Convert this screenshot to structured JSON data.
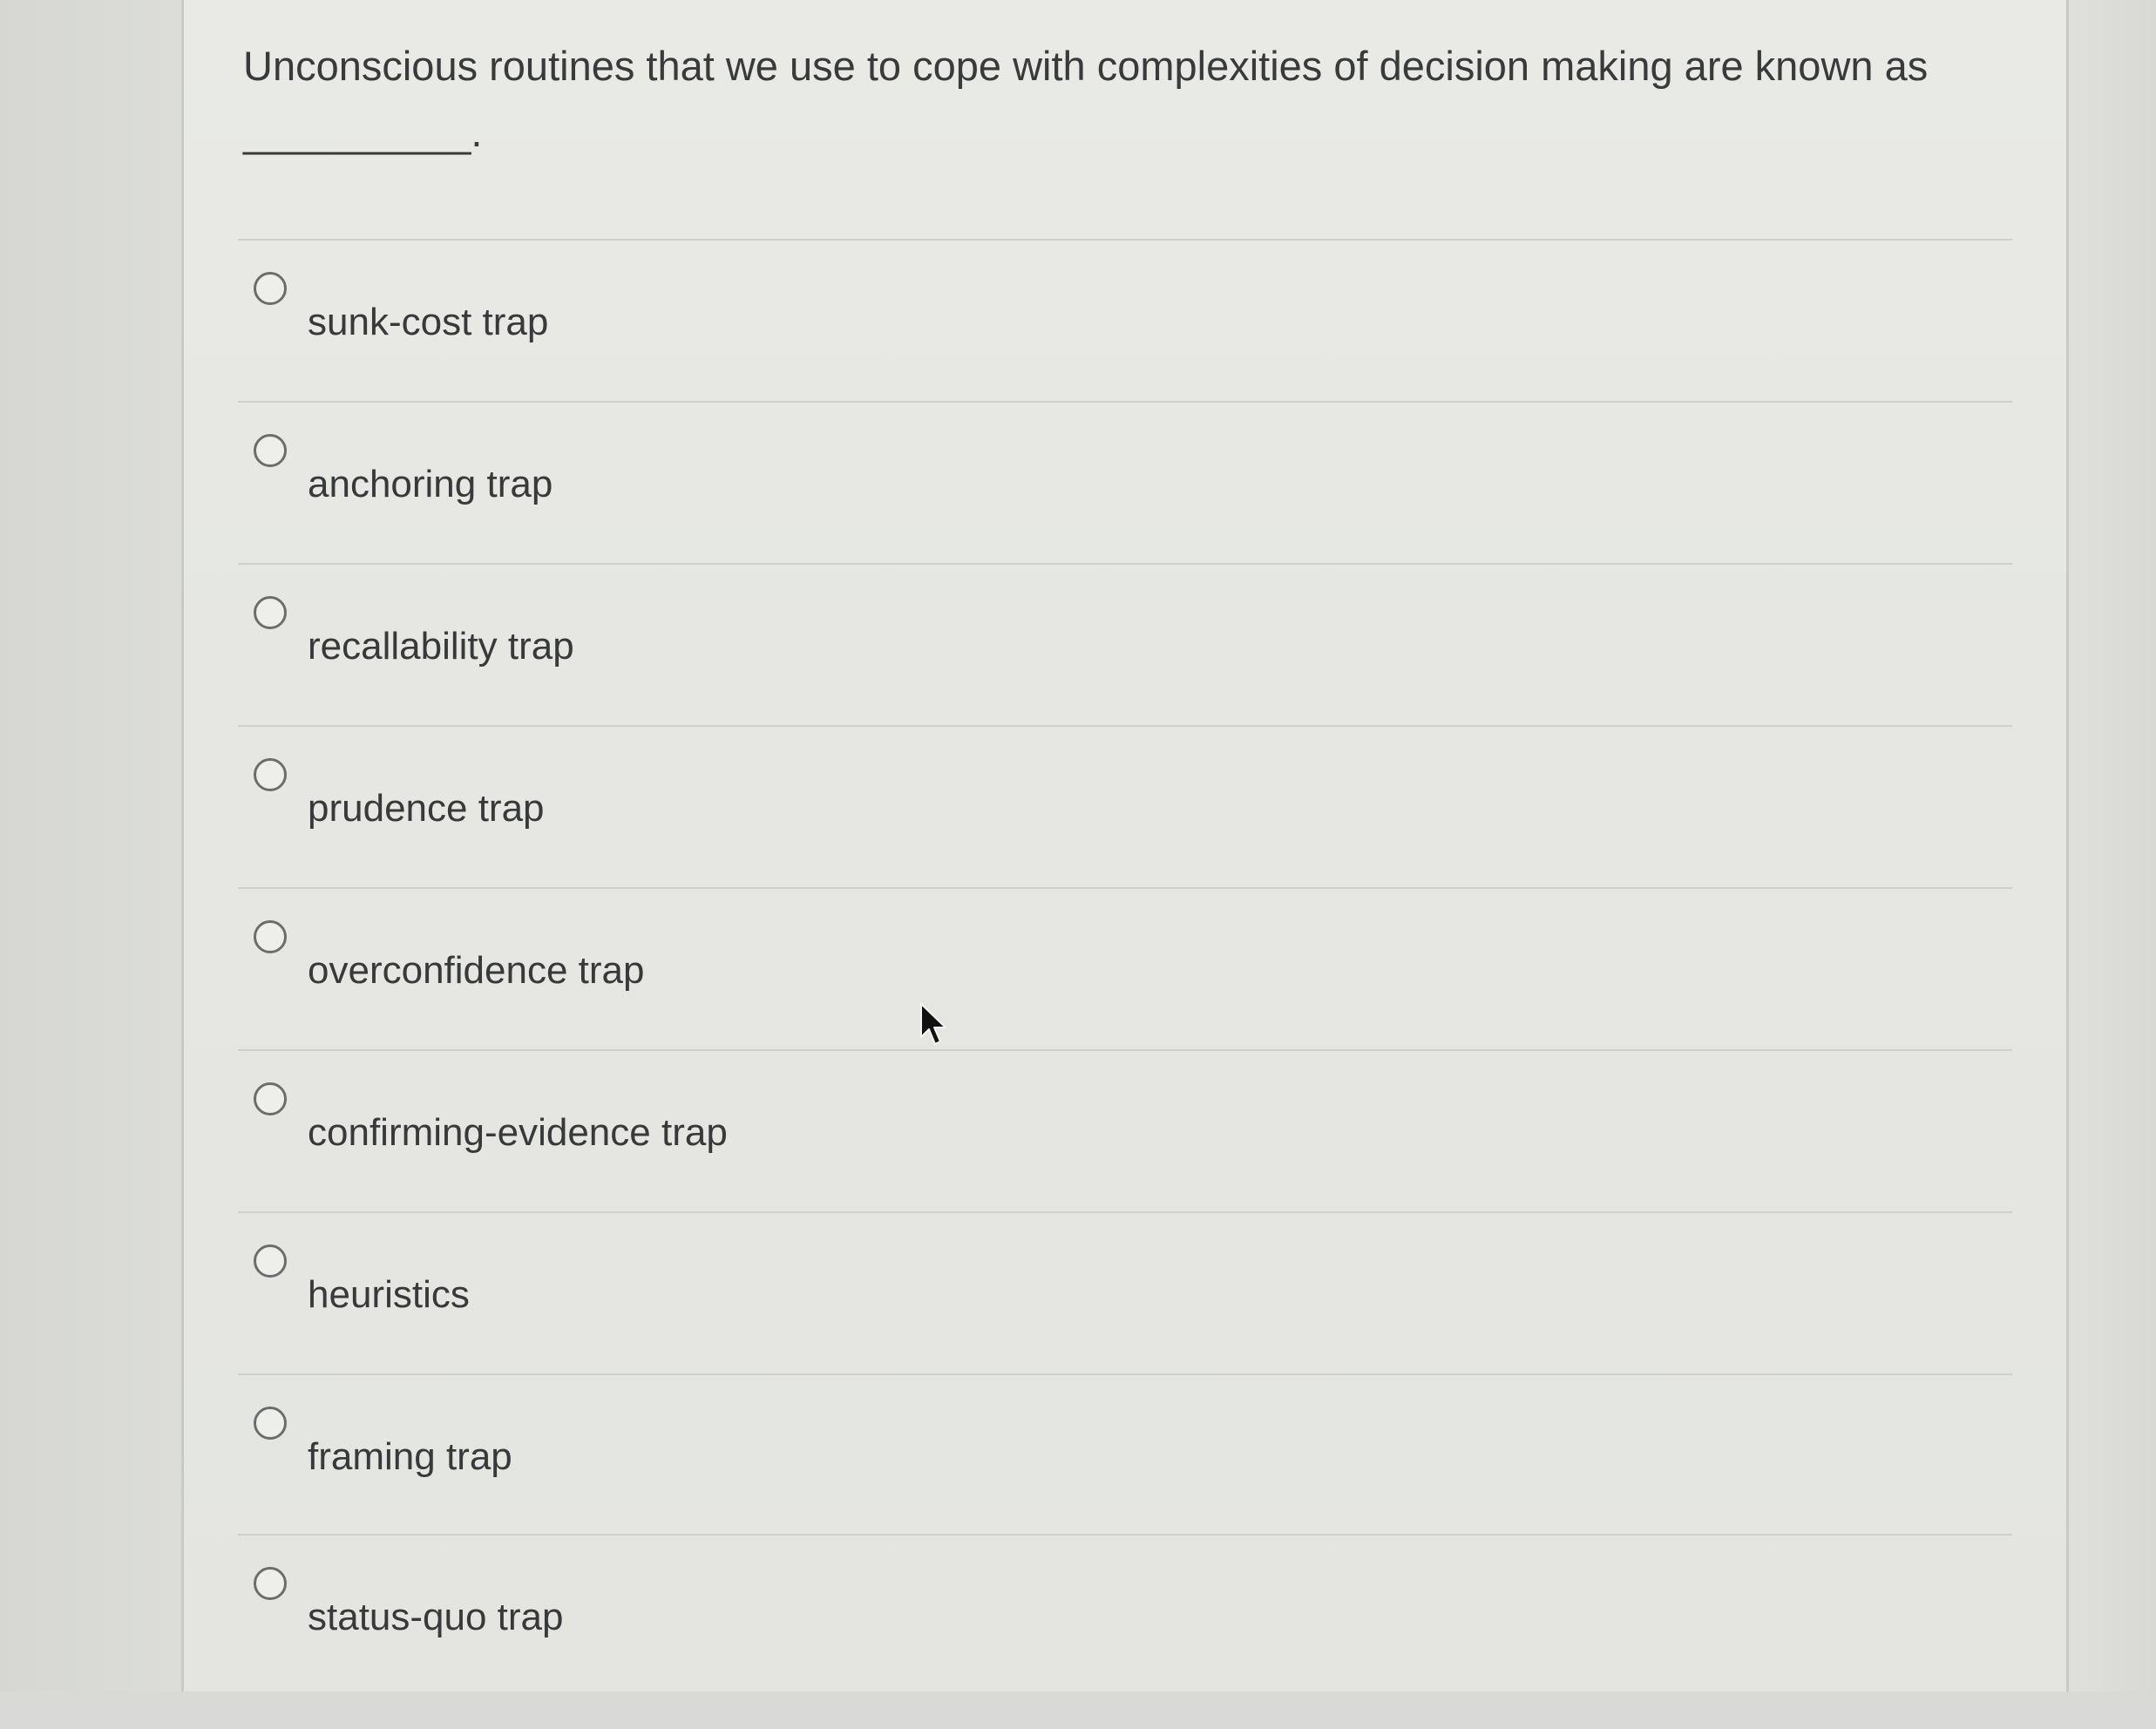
{
  "question": {
    "text": "Unconscious routines that we use to cope with complexities of decision making are known as __________."
  },
  "options": [
    {
      "label": "sunk-cost trap",
      "selected": false
    },
    {
      "label": "anchoring trap",
      "selected": false
    },
    {
      "label": "recallability trap",
      "selected": false
    },
    {
      "label": "prudence trap",
      "selected": false
    },
    {
      "label": "overconfidence trap",
      "selected": false
    },
    {
      "label": "confirming-evidence trap",
      "selected": false
    },
    {
      "label": "heuristics",
      "selected": false
    },
    {
      "label": "framing trap",
      "selected": false
    },
    {
      "label": "status-quo trap",
      "selected": false
    }
  ],
  "icons": {
    "radio": "radio-button-icon",
    "cursor": "mouse-pointer-icon"
  }
}
